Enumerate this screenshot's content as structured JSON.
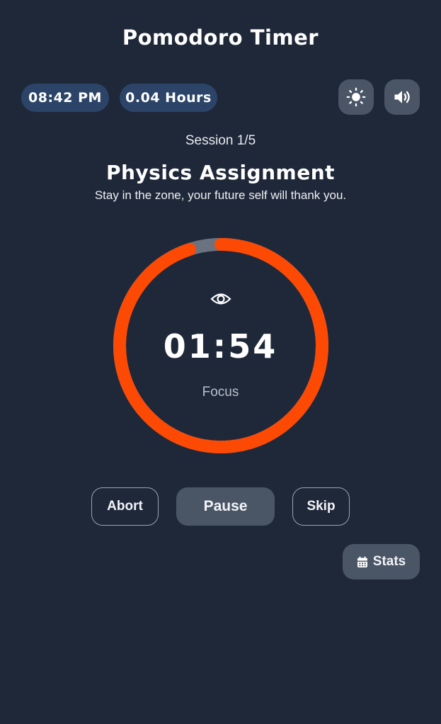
{
  "header": {
    "title": "Pomodoro Timer"
  },
  "status": {
    "clock": "08:42 PM",
    "hours": "0.04 Hours"
  },
  "toolbar": {
    "theme_icon": "sun-icon",
    "sound_icon": "speaker-volume-icon"
  },
  "session": {
    "counter": "Session 1/5",
    "task": "Physics Assignment",
    "motto": "Stay in the zone, your future self will thank you."
  },
  "timer": {
    "value": "01:54",
    "mode": "Focus",
    "icon": "eye-icon",
    "remaining_fraction": 0.95,
    "colors": {
      "progress": "#fc4a05",
      "track": "#6b7280"
    }
  },
  "controls": {
    "abort": "Abort",
    "pause": "Pause",
    "skip": "Skip"
  },
  "stats": {
    "label": "Stats",
    "icon": "calendar-icon"
  },
  "colors": {
    "background": "#1f2839",
    "pill": "#2b4468",
    "button": "#4a5566"
  }
}
